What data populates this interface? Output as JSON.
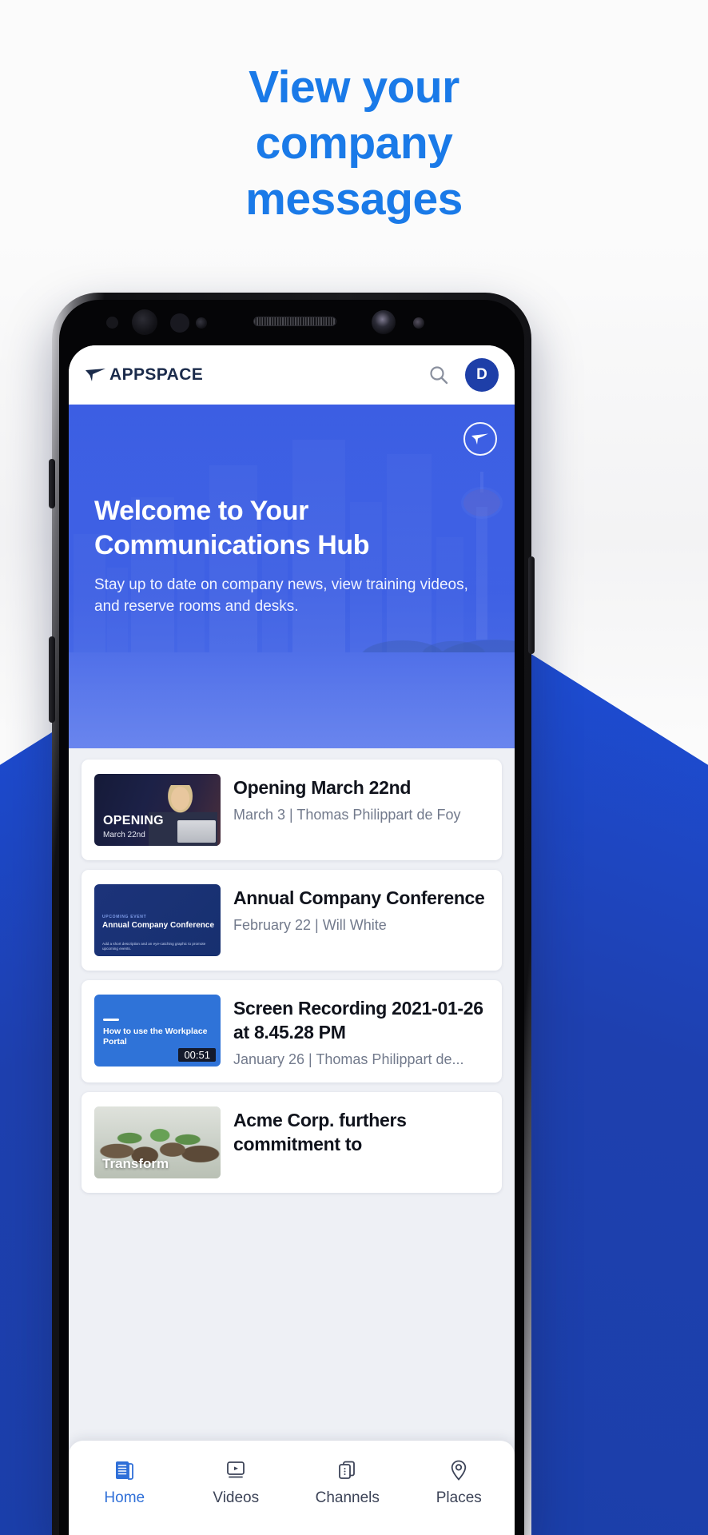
{
  "promo": {
    "headline_lines": [
      "View your",
      "company",
      "messages"
    ],
    "headline_color": "#1a7ae8"
  },
  "app": {
    "header": {
      "logo_text": "APPSPACE",
      "logo_mark_icon": "appspace-arrow-icon",
      "search_icon": "search-icon",
      "avatar_initial": "D",
      "avatar_color": "#1e3fa8"
    },
    "hero": {
      "badge_icon": "appspace-circle-logo-icon",
      "title": "Welcome to Your Communications Hub",
      "subtitle": "Stay up to date on company news, view training videos, and reserve rooms and desks.",
      "overlay_color": "#3e60e6"
    },
    "cards": [
      {
        "thumb_kind": "opening",
        "thumb_title": "OPENING",
        "thumb_sub": "March 22nd",
        "title": "Opening March 22nd",
        "meta": "March 3 | Thomas Philippart de Foy"
      },
      {
        "thumb_kind": "conference",
        "thumb_kicker": "UPCOMING EVENT",
        "thumb_title": "Annual Company Conference",
        "thumb_desc": "Add a short description and an eye-catching graphic to promote upcoming events.",
        "title": "Annual Company Conference",
        "meta": "February 22 | Will White"
      },
      {
        "thumb_kind": "video",
        "thumb_title": "How to use the Workplace Portal",
        "thumb_duration": "00:51",
        "title": "Screen Recording 2021-01-26 at 8.45.28 PM",
        "meta": "January 26 | Thomas Philippart de..."
      },
      {
        "thumb_kind": "transform",
        "thumb_title": "Transform",
        "title": "Acme Corp. furthers commitment to",
        "meta": ""
      }
    ],
    "bottom_nav": [
      {
        "label": "Home",
        "icon": "document-list-icon",
        "active": true
      },
      {
        "label": "Videos",
        "icon": "video-player-icon",
        "active": false
      },
      {
        "label": "Channels",
        "icon": "cards-stack-icon",
        "active": false
      },
      {
        "label": "Places",
        "icon": "map-pin-icon",
        "active": false
      }
    ]
  }
}
